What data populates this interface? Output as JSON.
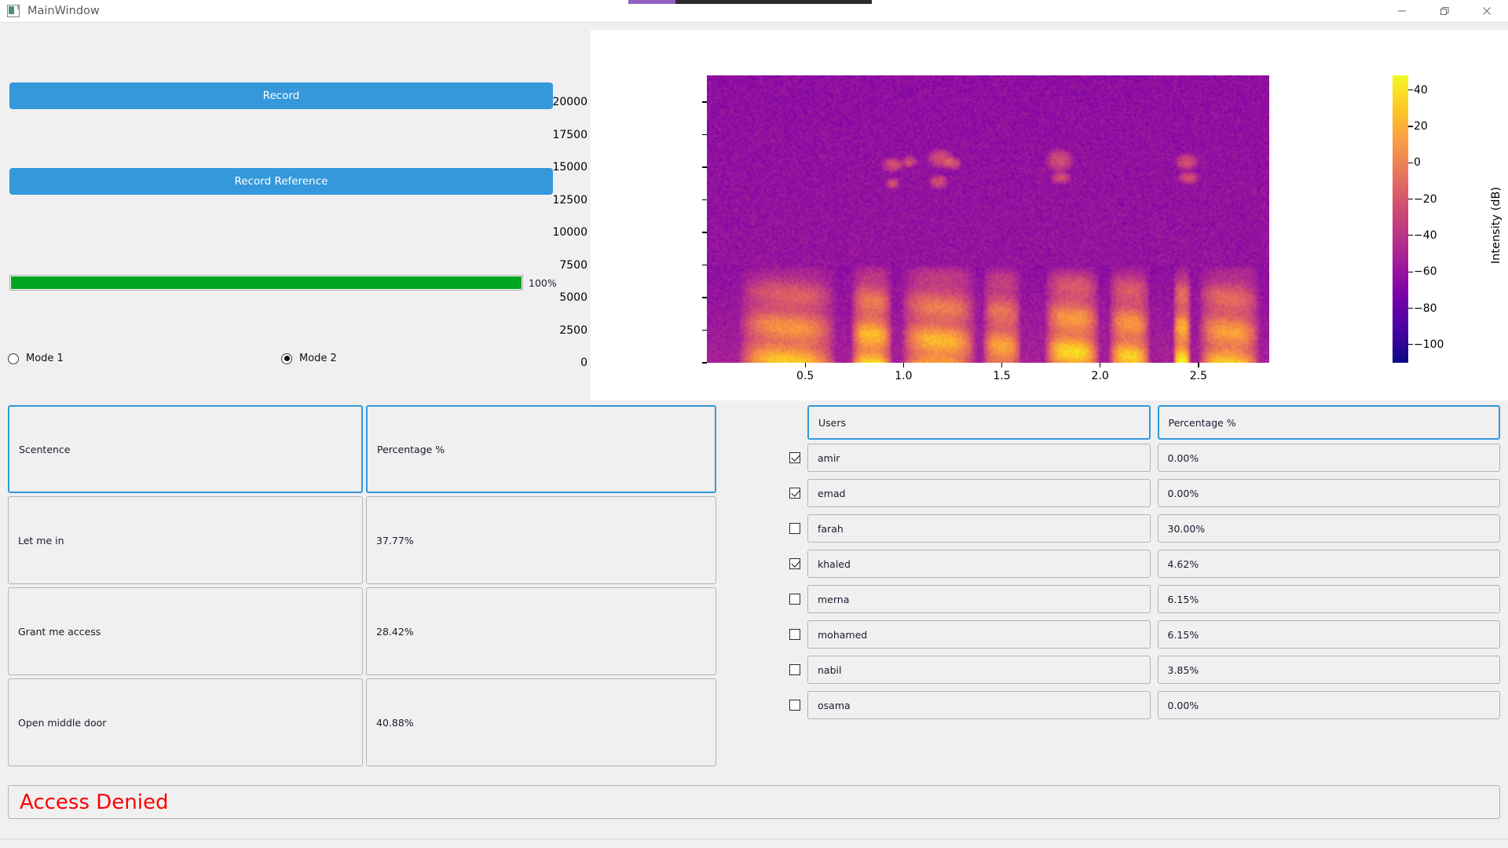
{
  "window": {
    "title": "MainWindow",
    "icon": "app-window-icon",
    "controls": [
      {
        "name": "minimize",
        "glyph": "—"
      },
      {
        "name": "maximize",
        "glyph": "❐"
      },
      {
        "name": "close",
        "glyph": "✕"
      }
    ]
  },
  "top_strip": {
    "accent_color": "#9061c2",
    "track_color": "#2b2b2b"
  },
  "controls": {
    "record_label": "Record",
    "record_reference_label": "Record Reference",
    "progress_value": 100,
    "progress_label": "100%",
    "progress_color": "#00a41e",
    "accent_color": "#3498db",
    "modes": [
      {
        "label": "Mode 1",
        "selected": false
      },
      {
        "label": "Mode 2",
        "selected": true
      }
    ]
  },
  "chart_data": {
    "type": "heatmap",
    "title": "",
    "xlabel": "",
    "ylabel": "",
    "colorbar_label": "Intensity (dB)",
    "colormap": "plasma",
    "xticks": [
      "0.5",
      "1.0",
      "1.5",
      "2.0",
      "2.5"
    ],
    "xtick_values": [
      0.5,
      1.0,
      1.5,
      2.0,
      2.5
    ],
    "yticks": [
      "0",
      "2500",
      "5000",
      "7500",
      "10000",
      "12500",
      "15000",
      "17500",
      "20000"
    ],
    "ytick_values": [
      0,
      2500,
      5000,
      7500,
      10000,
      12500,
      15000,
      17500,
      20000
    ],
    "xlim": [
      0.0,
      2.86
    ],
    "ylim": [
      0,
      22050
    ],
    "clim": [
      -110,
      48
    ],
    "cbticks": [
      "40",
      "20",
      "0",
      "−20",
      "−40",
      "−60",
      "−80",
      "−100"
    ],
    "cbtick_values": [
      40,
      20,
      0,
      -20,
      -40,
      -60,
      -80,
      -100
    ],
    "grid": false,
    "legend": "none",
    "description": "Audio spectrogram: broadband magenta noise floor above ~8 kHz with bright yellow speech energy below 7500 Hz in four utterance bursts near 0.3-1.5 s, 1.7-2.2 s and 2.4-2.8 s."
  },
  "sentence_table": {
    "headers": [
      "Scentence",
      "Percentage %"
    ],
    "rows": [
      {
        "sentence": "Let me in",
        "percentage": "37.77%"
      },
      {
        "sentence": "Grant me access",
        "percentage": "28.42%"
      },
      {
        "sentence": "Open middle door",
        "percentage": "40.88%"
      }
    ]
  },
  "users_table": {
    "headers": [
      "Users",
      "Percentage %"
    ],
    "rows": [
      {
        "checked": true,
        "user": "amir",
        "percentage": "0.00%"
      },
      {
        "checked": true,
        "user": "emad",
        "percentage": "0.00%"
      },
      {
        "checked": false,
        "user": "farah",
        "percentage": "30.00%"
      },
      {
        "checked": true,
        "user": "khaled",
        "percentage": "4.62%"
      },
      {
        "checked": false,
        "user": "merna",
        "percentage": "6.15%"
      },
      {
        "checked": false,
        "user": "mohamed",
        "percentage": "6.15%"
      },
      {
        "checked": false,
        "user": "nabil",
        "percentage": "3.85%"
      },
      {
        "checked": false,
        "user": "osama",
        "percentage": "0.00%"
      }
    ]
  },
  "footer": {
    "status_text": "Access Denied",
    "status_color": "#ff0000"
  }
}
